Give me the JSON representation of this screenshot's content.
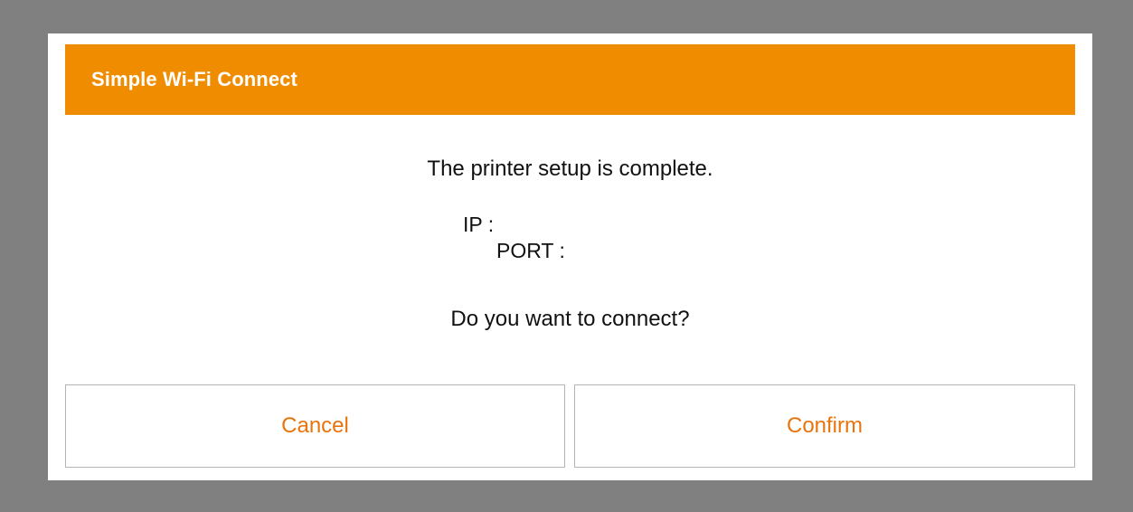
{
  "dialog": {
    "title": "Simple Wi-Fi Connect",
    "message": "The printer setup is complete.",
    "ip_label": "IP : ",
    "port_label": "PORT : ",
    "question": "Do you want to connect?",
    "cancel_label": "Cancel",
    "confirm_label": "Confirm"
  },
  "colors": {
    "accent": "#f08c00",
    "button_text": "#e8740c",
    "backdrop": "#808080"
  }
}
